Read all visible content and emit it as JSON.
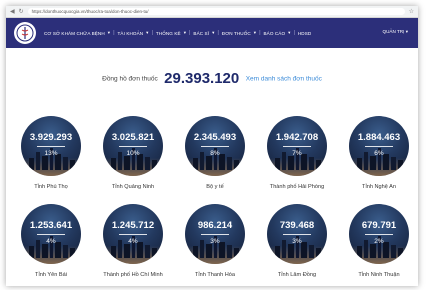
{
  "browser": {
    "url": "https://donthuocquocgia.vn/thuoc/ra-toa/don-thuoc-dien-tu/"
  },
  "navbar": {
    "menu": [
      "CƠ SỞ KHÁM CHỮA BỆNH",
      "TÀI KHOẢN",
      "THỐNG KÊ",
      "BÁC SĨ",
      "ĐƠN THUỐC",
      "BÁO CÁO",
      "HDSD"
    ],
    "user_label": "QUẢN TRỊ"
  },
  "counter": {
    "label": "Đồng hồ đơn thuốc",
    "value": "29.393.120",
    "link": "Xem danh sách đơn thuốc"
  },
  "provinces": [
    {
      "value": "3.929.293",
      "percent": "13%",
      "name": "Tỉnh Phú Thọ"
    },
    {
      "value": "3.025.821",
      "percent": "10%",
      "name": "Tỉnh Quảng Ninh"
    },
    {
      "value": "2.345.493",
      "percent": "8%",
      "name": "Bộ y tế"
    },
    {
      "value": "1.942.708",
      "percent": "7%",
      "name": "Thành phố Hải Phòng"
    },
    {
      "value": "1.884.463",
      "percent": "6%",
      "name": "Tỉnh Nghệ An"
    },
    {
      "value": "1.253.641",
      "percent": "4%",
      "name": "Tỉnh Yên Bái"
    },
    {
      "value": "1.245.712",
      "percent": "4%",
      "name": "Thành phố Hồ Chí Minh"
    },
    {
      "value": "986.214",
      "percent": "3%",
      "name": "Tỉnh Thanh Hóa"
    },
    {
      "value": "739.468",
      "percent": "3%",
      "name": "Tỉnh Lâm Đồng"
    },
    {
      "value": "679.791",
      "percent": "2%",
      "name": "Tỉnh Ninh Thuận"
    }
  ],
  "colors": {
    "navbar": "#2c2f7a",
    "counter_value": "#1f2a6b",
    "link": "#3b8bd8"
  }
}
